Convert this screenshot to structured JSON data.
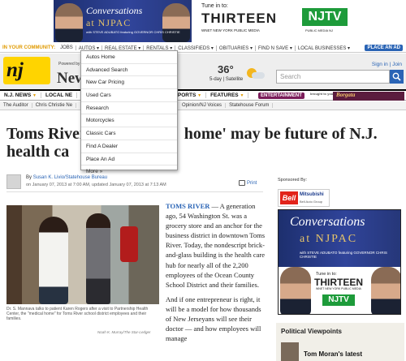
{
  "top_ad": {
    "njpac_title": "Conversations",
    "njpac_at": "at NJPAC",
    "njpac_with": "with STEVE ADUBATO featuring GOVERNOR CHRIS CHRISTIE",
    "tune_in": "Tune in to:",
    "thirteen": "THIRTEEN",
    "wnet": "WNET NEW YORK PUBLIC MEDIA",
    "njtv": "NJTV",
    "njtv_sub": "PUBLIC MEDIA NJ"
  },
  "community_bar": {
    "label": "IN YOUR COMMUNITY:",
    "items": [
      "JOBS",
      "AUTOS",
      "REAL ESTATE",
      "RENTALS",
      "CLASSIFIEDS",
      "OBITUARIES",
      "FIND N SAVE",
      "LOCAL BUSINESSES"
    ],
    "place_ad": "PLACE AN AD"
  },
  "header": {
    "logo": "nj",
    "powered_by": "Powered by",
    "title_partial": "New",
    "temperature": "36°",
    "forecast": "5-day | Satellite",
    "sign_in": "Sign in | Join",
    "search_placeholder": "Search"
  },
  "nav": {
    "items": [
      "N.J. NEWS",
      "LOCAL NE",
      "H.S. SPORTS",
      "FEATURES",
      "ENTERTAINMENT"
    ],
    "brought_by": "brought to you by",
    "sponsor": "Borgata"
  },
  "subnav": {
    "items": [
      "The Auditor",
      "Chris Christie Ne",
      "Opinion/NJ Voices",
      "Statehouse Forum"
    ]
  },
  "dropdown": {
    "items": [
      "Autos Home",
      "Advanced Search",
      "New Car Pricing",
      "Used Cars",
      "Research",
      "Motorcycles",
      "Classic Cars",
      "Find A Dealer",
      "Place An Ad",
      "More"
    ]
  },
  "article": {
    "headline_a": "Toms River",
    "headline_b": "home' may be future of N.J.",
    "headline_c": "health ca",
    "by": "By",
    "author": "Susan K. Livio/Statehouse Bureau",
    "dates": "on January 07, 2013 at 7:00 AM, updated January 07, 2013 at 7:13 AM",
    "print": "Print",
    "city": "TOMS RIVER",
    "para1": " — A generation ago, 54 Washington St. was a grocery store and an anchor for the business district in downtown Toms River. Today, the nondescript brick-and-glass building is the health care hub for nearly all of the 2,200 employees of the Ocean County School District and their families.",
    "para2": "And if one entrepreneur is right, it will be a model for how thousands of New Jerseyans will see their doctor — and how employees will manage",
    "caption": "Dr. S. Mannava talks to patient Karen Rogers after a visit to Partnership Health Center, the \"medical home\" for Toms River school district employees and their families.",
    "credit": "Noah K. Murray/The Star-Ledger"
  },
  "sidebar": {
    "sponsored_by": "Sponsored By:",
    "bell": "Bell",
    "mitsubishi": "Mitsubishi",
    "bell_sub": "Bell Auto Group",
    "ad_title": "Conversations",
    "ad_at": "at NJPAC",
    "ad_with": "with STEVE ADUBATO featuring GOVERNOR CHRIS CHRISTIE",
    "tune_in": "Tune in to:",
    "thirteen": "THIRTEEN",
    "wnet": "WNET NEW YORK PUBLIC MEDIA",
    "njtv": "NJTV",
    "political_viewpoints": "Political Viewpoints",
    "latest": "Tom Moran's latest"
  },
  "colors": {
    "accent_blue": "#2a64b5",
    "community_orange": "#e09a00",
    "logo_yellow": "#ffd400",
    "njtv_green": "#1d9b3a"
  }
}
